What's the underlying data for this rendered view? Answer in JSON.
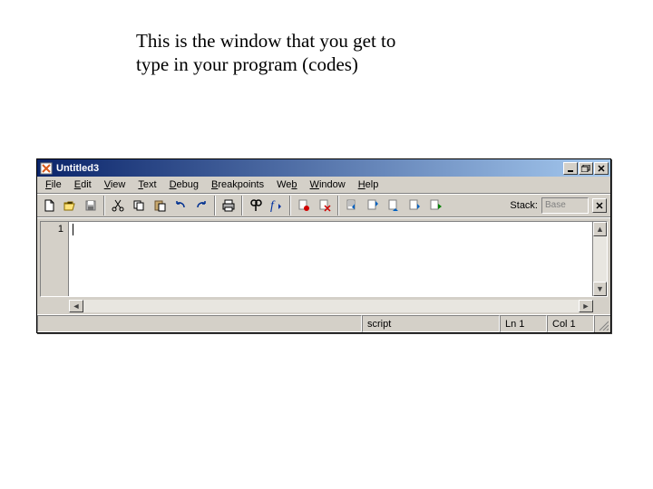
{
  "annotation": "This is the window that you get to\ntype in your program (codes)",
  "window": {
    "title": "Untitled3"
  },
  "menu": {
    "file": {
      "pre": "",
      "u": "F",
      "post": "ile"
    },
    "edit": {
      "pre": "",
      "u": "E",
      "post": "dit"
    },
    "view": {
      "pre": "",
      "u": "V",
      "post": "iew"
    },
    "text": {
      "pre": "",
      "u": "T",
      "post": "ext"
    },
    "debug": {
      "pre": "",
      "u": "D",
      "post": "ebug"
    },
    "breakpoints": {
      "pre": "",
      "u": "B",
      "post": "reakpoints"
    },
    "web": {
      "pre": "We",
      "u": "b",
      "post": ""
    },
    "window": {
      "pre": "",
      "u": "W",
      "post": "indow"
    },
    "help": {
      "pre": "",
      "u": "H",
      "post": "elp"
    }
  },
  "stack": {
    "label": "Stack:",
    "value": "Base"
  },
  "editor": {
    "line_number": "1"
  },
  "status": {
    "type": "script",
    "line": "Ln 1",
    "col": "Col 1"
  },
  "icons": {
    "new": "new-file-icon",
    "open": "open-folder-icon",
    "save": "save-icon",
    "cut": "cut-icon",
    "copy": "copy-icon",
    "paste": "paste-icon",
    "undo": "undo-icon",
    "redo": "redo-icon",
    "print": "print-icon",
    "find": "find-icon",
    "function": "function-icon",
    "setbreak": "set-breakpoint-icon",
    "clearbreak": "clear-breakpoint-icon",
    "stepin": "step-in-icon",
    "stepover": "step-over-icon",
    "stepout": "step-out-icon",
    "rundown": "run-to-cursor-icon",
    "continue": "continue-icon"
  }
}
